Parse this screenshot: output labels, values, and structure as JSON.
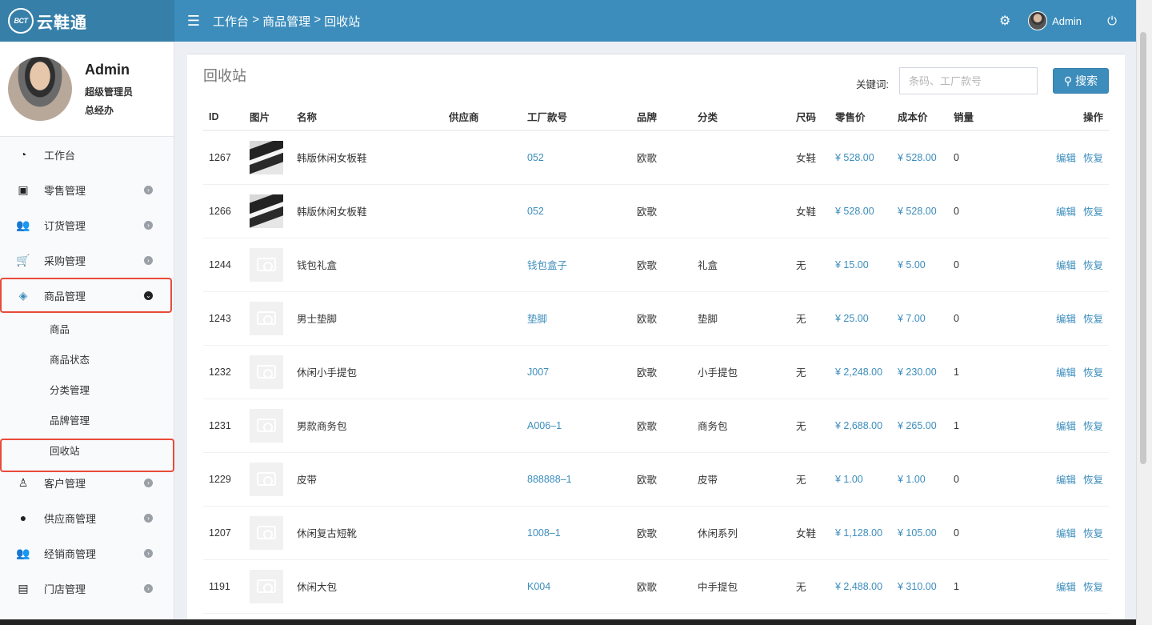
{
  "brand": {
    "badge": "BCT",
    "name": "云鞋通"
  },
  "topbar": {
    "breadcrumb": [
      "工作台",
      "商品管理",
      "回收站"
    ],
    "separator": ">",
    "username": "Admin",
    "icons": {
      "menu": "hamburger-icon",
      "settings": "gear-icon",
      "power": "power-icon"
    }
  },
  "sidebar": {
    "user": {
      "name": "Admin",
      "role": "超级管理员",
      "title": "总经办"
    },
    "items": [
      {
        "label": "工作台",
        "icon": "dashboard-icon",
        "glyph": "◔",
        "arrow": false
      },
      {
        "label": "零售管理",
        "icon": "money-icon",
        "glyph": "▣",
        "arrow": true
      },
      {
        "label": "订货管理",
        "icon": "users-icon",
        "glyph": "👥",
        "arrow": true
      },
      {
        "label": "采购管理",
        "icon": "cart-icon",
        "glyph": "🛒",
        "arrow": true
      },
      {
        "label": "商品管理",
        "icon": "cubes-icon",
        "glyph": "◈",
        "arrow": true
      }
    ],
    "subitems": [
      "商品",
      "商品状态",
      "分类管理",
      "品牌管理",
      "回收站"
    ],
    "items_after": [
      {
        "label": "客户管理",
        "icon": "person-icon",
        "glyph": "♙",
        "arrow": true
      },
      {
        "label": "供应商管理",
        "icon": "user-icon",
        "glyph": "●",
        "arrow": true
      },
      {
        "label": "经销商管理",
        "icon": "group-icon",
        "glyph": "👥",
        "arrow": true
      },
      {
        "label": "门店管理",
        "icon": "archive-icon",
        "glyph": "▤",
        "arrow": true
      }
    ]
  },
  "content": {
    "title": "回收站",
    "search_label": "关键词:",
    "search_placeholder": "条码、工厂款号",
    "search_button": "搜索",
    "columns": [
      "ID",
      "图片",
      "名称",
      "供应商",
      "工厂款号",
      "品牌",
      "分类",
      "尺码",
      "零售价",
      "成本价",
      "销量",
      "操作"
    ],
    "action_edit": "编辑",
    "action_restore": "恢复",
    "rows": [
      {
        "id": "1267",
        "image": "shoe",
        "name": "韩版休闲女板鞋",
        "supplier": "",
        "code": "052",
        "brand": "欧歌",
        "category": "",
        "size": "女鞋",
        "retail": "¥ 528.00",
        "cost": "¥ 528.00",
        "sales": "0"
      },
      {
        "id": "1266",
        "image": "shoe",
        "name": "韩版休闲女板鞋",
        "supplier": "",
        "code": "052",
        "brand": "欧歌",
        "category": "",
        "size": "女鞋",
        "retail": "¥ 528.00",
        "cost": "¥ 528.00",
        "sales": "0"
      },
      {
        "id": "1244",
        "image": "placeholder",
        "name": "钱包礼盒",
        "supplier": "",
        "code": "钱包盒子",
        "brand": "欧歌",
        "category": "礼盒",
        "size": "无",
        "retail": "¥ 15.00",
        "cost": "¥ 5.00",
        "sales": "0"
      },
      {
        "id": "1243",
        "image": "placeholder",
        "name": "男士垫脚",
        "supplier": "",
        "code": "垫脚",
        "brand": "欧歌",
        "category": "垫脚",
        "size": "无",
        "retail": "¥ 25.00",
        "cost": "¥ 7.00",
        "sales": "0"
      },
      {
        "id": "1232",
        "image": "placeholder",
        "name": "休闲小手提包",
        "supplier": "",
        "code": "J007",
        "brand": "欧歌",
        "category": "小手提包",
        "size": "无",
        "retail": "¥ 2,248.00",
        "cost": "¥ 230.00",
        "sales": "1"
      },
      {
        "id": "1231",
        "image": "placeholder",
        "name": "男款商务包",
        "supplier": "",
        "code": "A006–1",
        "brand": "欧歌",
        "category": "商务包",
        "size": "无",
        "retail": "¥ 2,688.00",
        "cost": "¥ 265.00",
        "sales": "1"
      },
      {
        "id": "1229",
        "image": "placeholder",
        "name": "皮带",
        "supplier": "",
        "code": "888888–1",
        "brand": "欧歌",
        "category": "皮带",
        "size": "无",
        "retail": "¥ 1.00",
        "cost": "¥ 1.00",
        "sales": "0"
      },
      {
        "id": "1207",
        "image": "placeholder",
        "name": "休闲复古短靴",
        "supplier": "",
        "code": "1008–1",
        "brand": "欧歌",
        "category": "休闲系列",
        "size": "女鞋",
        "retail": "¥ 1,128.00",
        "cost": "¥ 105.00",
        "sales": "0"
      },
      {
        "id": "1191",
        "image": "placeholder",
        "name": "休闲大包",
        "supplier": "",
        "code": "K004",
        "brand": "欧歌",
        "category": "中手提包",
        "size": "无",
        "retail": "¥ 2,488.00",
        "cost": "¥ 310.00",
        "sales": "1"
      }
    ]
  },
  "colors": {
    "header": "#3c8dbc",
    "logo_bg": "#367fa9",
    "link": "#3c8dbc",
    "highlight": "#e84b3a"
  }
}
